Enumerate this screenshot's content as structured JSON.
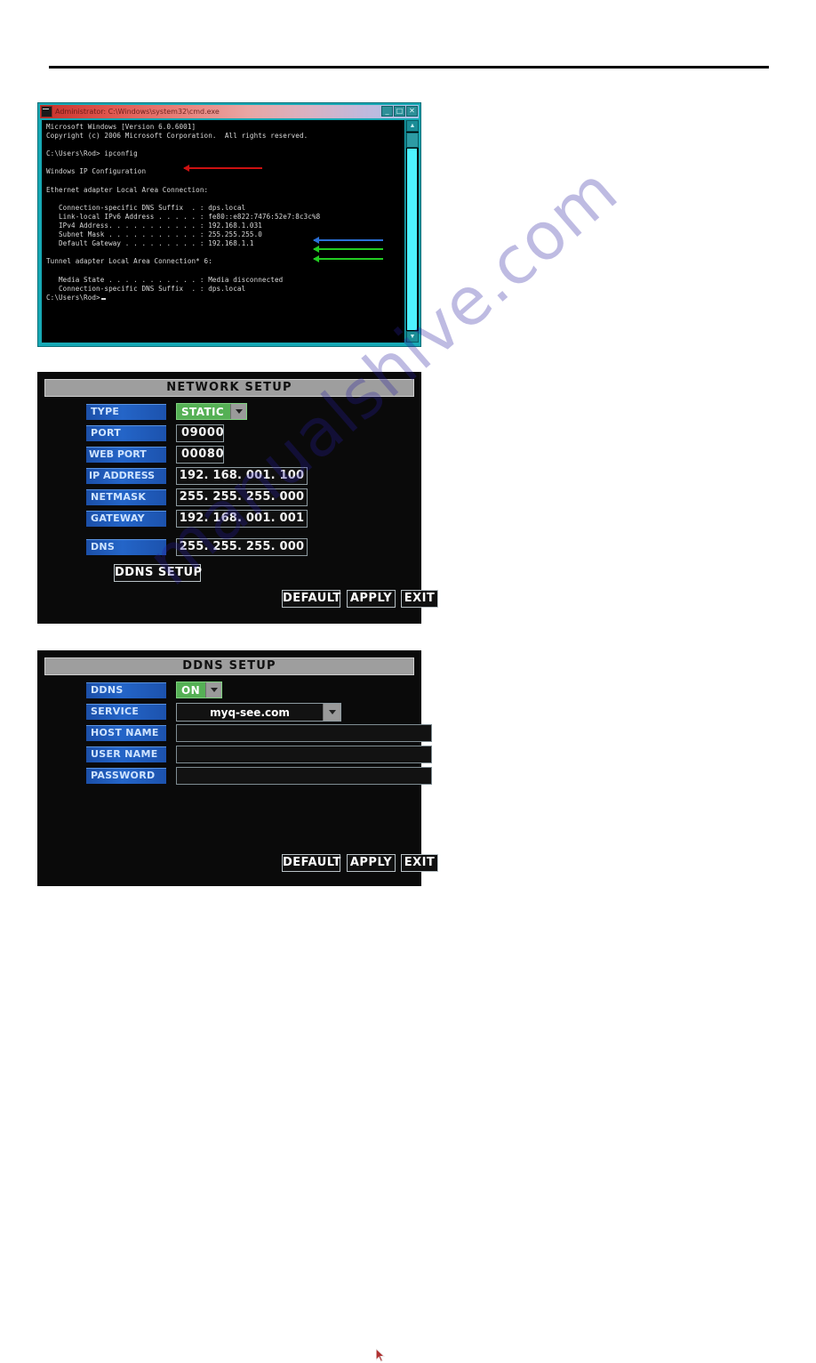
{
  "terminal": {
    "title": "Administrator: C:\\Windows\\system32\\cmd.exe",
    "window_buttons": [
      "_",
      "□",
      "✕"
    ],
    "scroll_up": "▲",
    "scroll_down": "▼",
    "lines": "Microsoft Windows [Version 6.0.6001]\nCopyright (c) 2006 Microsoft Corporation.  All rights reserved.\n\nC:\\Users\\Rod> ipconfig\n\nWindows IP Configuration\n\nEthernet adapter Local Area Connection:\n\n   Connection-specific DNS Suffix  . : dps.local\n   Link-local IPv6 Address . . . . . : fe80::e822:7476:52e7:8c3c%8\n   IPv4 Address. . . . . . . . . . . : 192.168.1.031\n   Subnet Mask . . . . . . . . . . . : 255.255.255.0\n   Default Gateway . . . . . . . . . : 192.168.1.1\n\nTunnel adapter Local Area Connection* 6:\n\n   Media State . . . . . . . . . . . : Media disconnected\n   Connection-specific DNS Suffix  . : dps.local\n",
    "prompt": "C:\\Users\\Rod>",
    "annotations": {
      "ipconfig_arrow_color": "#cc1111",
      "ipv4_arrow_color": "#2a6fd6",
      "subnet_arrow_color": "#22cc22",
      "gateway_arrow_color": "#22cc22"
    }
  },
  "network_setup": {
    "title": "NETWORK  SETUP",
    "rows": [
      {
        "label": "TYPE",
        "value": "STATIC"
      },
      {
        "label": "PORT",
        "value": "09000"
      },
      {
        "label": "WEB    PORT",
        "value": "00080"
      },
      {
        "label": "IP ADDRESS",
        "value": "192. 168. 001. 100"
      },
      {
        "label": "NETMASK",
        "value": "255. 255. 255. 000"
      },
      {
        "label": "GATEWAY",
        "value": "192. 168. 001. 001"
      },
      {
        "label": "DNS",
        "value": "255. 255. 255. 000"
      }
    ],
    "ddns_setup_button": "DDNS  SETUP",
    "buttons": [
      "DEFAULT",
      "APPLY",
      "EXIT"
    ]
  },
  "ddns_setup": {
    "title": "DDNS SETUP",
    "rows": [
      {
        "label": "DDNS",
        "value": "ON"
      },
      {
        "label": "SERVICE",
        "value": "myq-see.com"
      },
      {
        "label": "HOST NAME",
        "value": ""
      },
      {
        "label": "USER NAME",
        "value": ""
      },
      {
        "label": "PASSWORD",
        "value": ""
      }
    ],
    "buttons": [
      "DEFAULT",
      "APPLY",
      "EXIT"
    ]
  },
  "watermark": {
    "text": "manualshive.com"
  }
}
